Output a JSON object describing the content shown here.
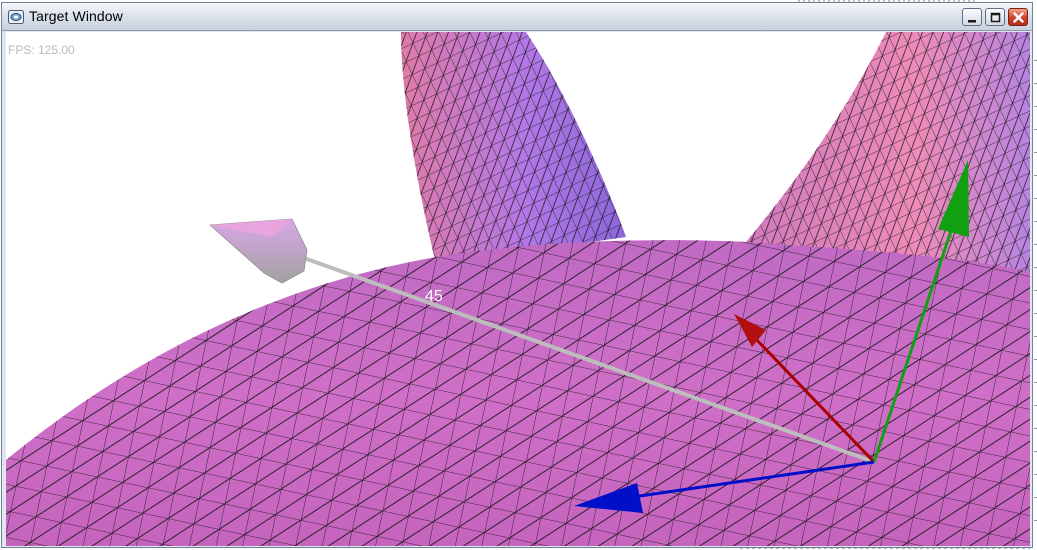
{
  "window": {
    "title": "Target Window",
    "app_icon": "app-window-icon",
    "controls": {
      "minimize_icon": "minimize-icon",
      "maximize_icon": "maximize-icon",
      "close_icon": "close-icon"
    }
  },
  "viewport": {
    "fps_text": "FPS: 125.00",
    "angle_label": "45",
    "background_color": "#ffffff",
    "mesh_color": "#d070c8",
    "wire_color": "#111111"
  },
  "gizmo": {
    "x_axis_color": "#aa0000",
    "y_axis_color": "#10a010",
    "z_axis_color": "#0010c8",
    "pointer_color": "#bdbdbd",
    "cone_colors": [
      "#e6a0e6",
      "#9a9a9a"
    ]
  }
}
